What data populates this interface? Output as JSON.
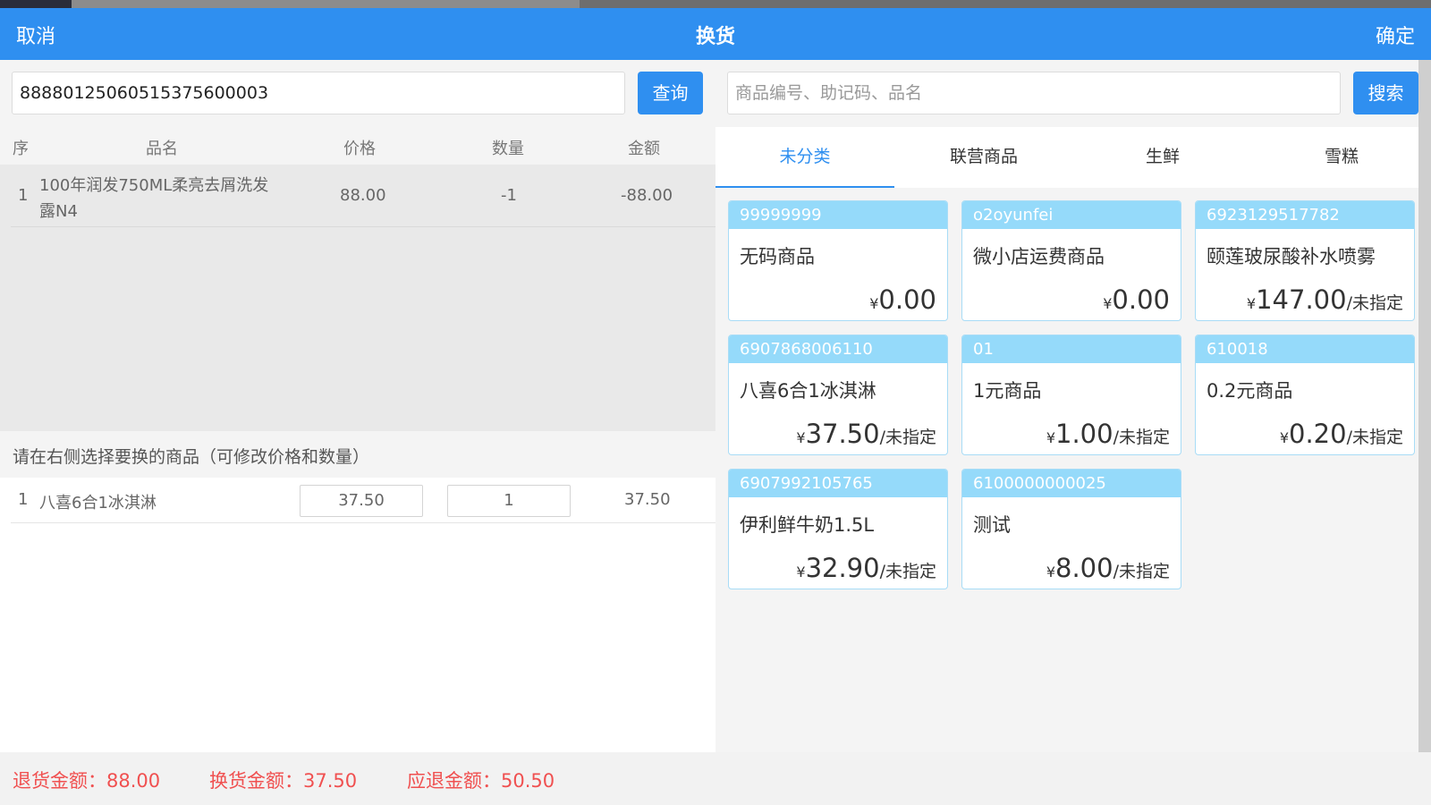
{
  "header": {
    "cancel": "取消",
    "title": "换货",
    "confirm": "确定"
  },
  "left": {
    "order_input_value": "88880125060515375600003",
    "query_button": "查询",
    "columns": {
      "seq": "序",
      "name": "品名",
      "price": "价格",
      "qty": "数量",
      "amount": "金额"
    },
    "return_items": [
      {
        "seq": "1",
        "name_line1": "100年润发750ML柔亮去屑洗发",
        "name_line2": "露N4",
        "price": "88.00",
        "qty": "-1",
        "amount": "-88.00"
      }
    ],
    "hint": "请在右侧选择要换的商品（可修改价格和数量）",
    "exchange_items": [
      {
        "seq": "1",
        "name": "八喜6合1冰淇淋",
        "price": "37.50",
        "qty": "1",
        "amount": "37.50"
      }
    ]
  },
  "right": {
    "search_placeholder": "商品编号、助记码、品名",
    "search_button": "搜索",
    "tabs": [
      "未分类",
      "联营商品",
      "生鲜",
      "雪糕"
    ],
    "active_tab": 0,
    "products": [
      {
        "code": "99999999",
        "name": "无码商品",
        "yen": "¥",
        "price": "0.00",
        "unit": ""
      },
      {
        "code": "o2oyunfei",
        "name": "微小店运费商品",
        "yen": "¥",
        "price": "0.00",
        "unit": ""
      },
      {
        "code": "6923129517782",
        "name": "颐莲玻尿酸补水喷雾",
        "yen": "¥",
        "price": "147.00",
        "unit": "/未指定"
      },
      {
        "code": "6907868006110",
        "name": "八喜6合1冰淇淋",
        "yen": "¥",
        "price": "37.50",
        "unit": "/未指定"
      },
      {
        "code": "01",
        "name": "1元商品",
        "yen": "¥",
        "price": "1.00",
        "unit": "/未指定"
      },
      {
        "code": "610018",
        "name": "0.2元商品",
        "yen": "¥",
        "price": "0.20",
        "unit": "/未指定"
      },
      {
        "code": "6907992105765",
        "name": "伊利鲜牛奶1.5L",
        "yen": "¥",
        "price": "32.90",
        "unit": "/未指定"
      },
      {
        "code": "6100000000025",
        "name": "测试",
        "yen": "¥",
        "price": "8.00",
        "unit": "/未指定"
      }
    ]
  },
  "footer": {
    "return_amount": "退货金额：88.00",
    "exchange_amount": "换货金额：37.50",
    "refund_amount": "应退金额：50.50"
  },
  "colors": {
    "primary": "#2f8ff0",
    "card_header": "#95dafa",
    "footer_text": "#f05050"
  }
}
